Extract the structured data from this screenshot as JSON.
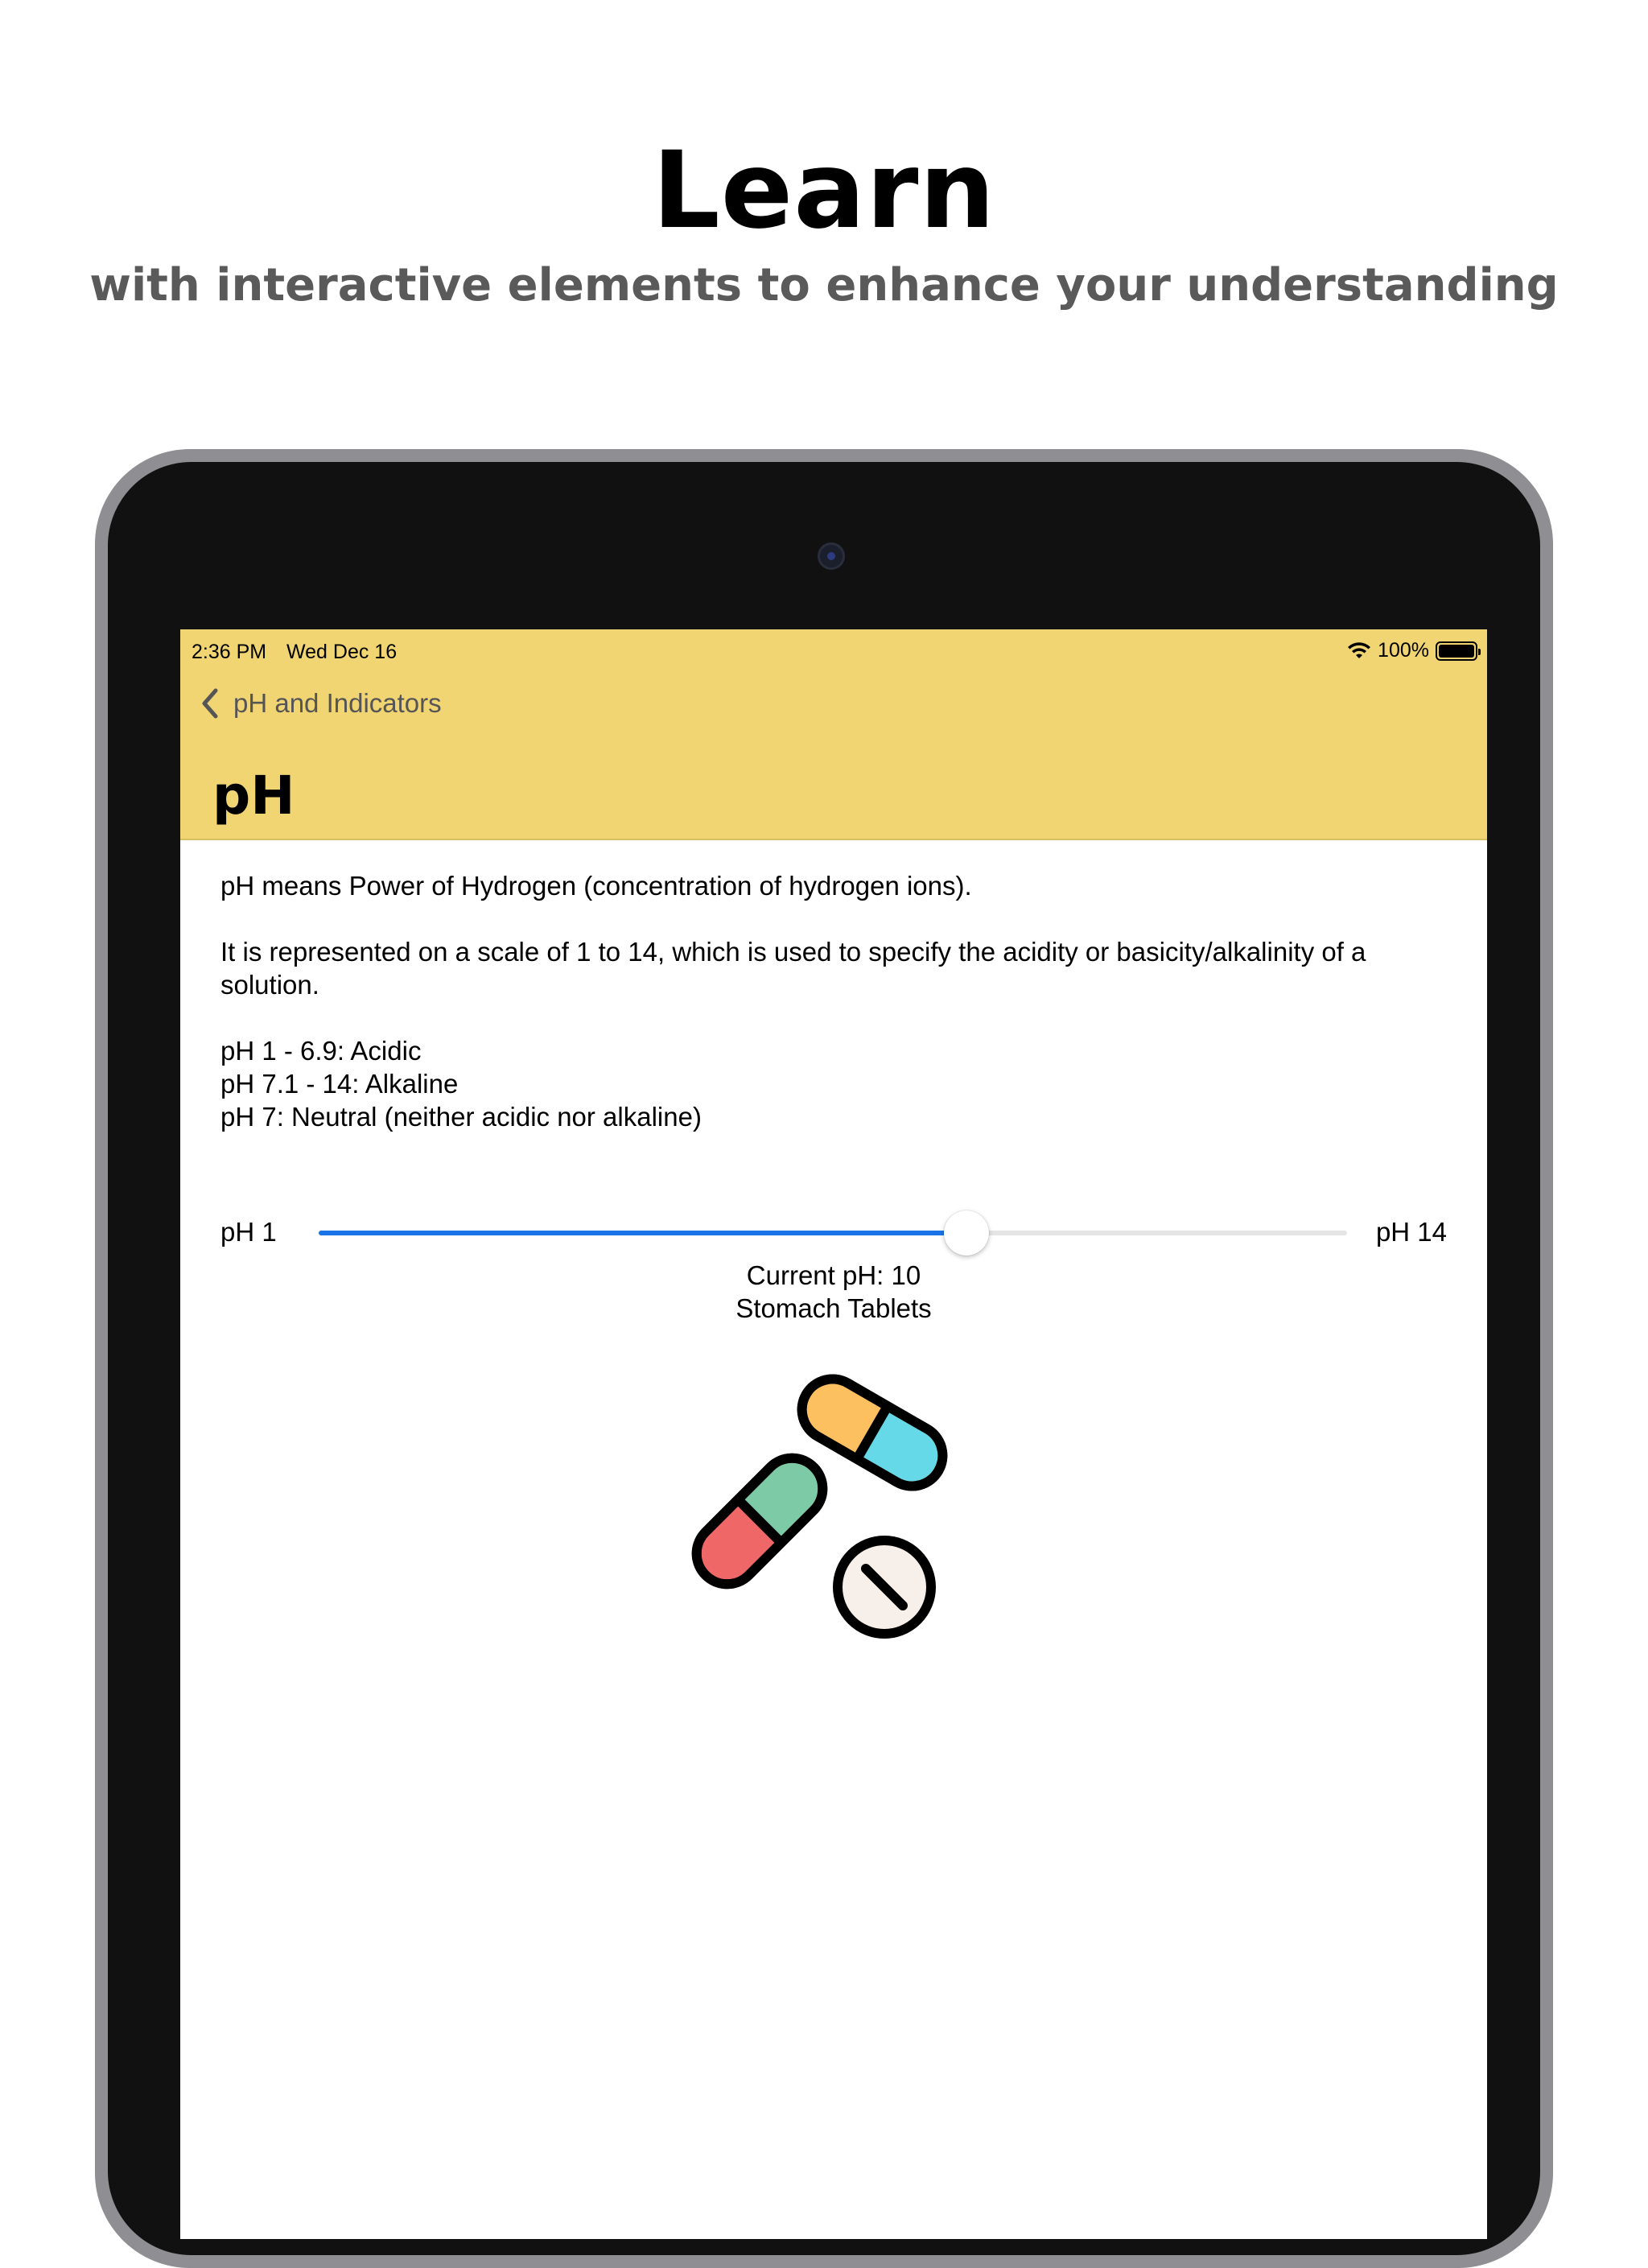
{
  "hero": {
    "title": "Learn",
    "subtitle": "with interactive elements to enhance your understanding"
  },
  "status_bar": {
    "time": "2:36 PM",
    "date": "Wed Dec 16",
    "battery": "100%"
  },
  "nav": {
    "back_label": "pH and Indicators",
    "title": "pH",
    "background_color": "#f1d573"
  },
  "content": {
    "intro": "pH means Power of Hydrogen (concentration of hydrogen ions).",
    "scale_text": "It is represented on a scale of 1 to 14, which is used to specify the acidity or basicity/alkalinity of a solution.",
    "ranges": [
      "pH 1 - 6.9: Acidic",
      "pH 7.1 - 14:  Alkaline",
      "pH 7: Neutral (neither acidic nor alkaline)"
    ]
  },
  "slider": {
    "min_label": "pH 1",
    "max_label": "pH 14",
    "min": 1,
    "max": 14,
    "value": 10,
    "accent_color": "#1a74e8"
  },
  "readout": {
    "current": "Current pH: 10",
    "substance": "Stomach Tablets"
  },
  "illustration": {
    "icon": "pills-icon"
  }
}
